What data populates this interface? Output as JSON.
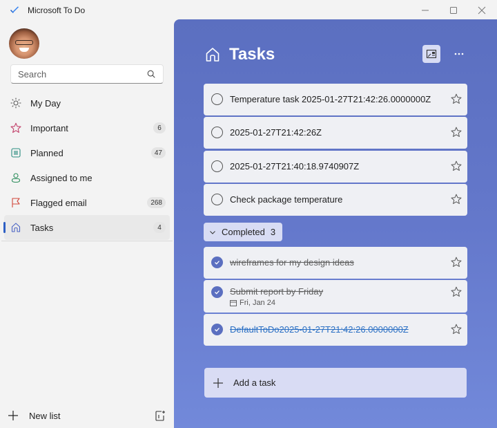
{
  "window": {
    "title": "Microsoft To Do",
    "controls": [
      "minimize",
      "maximize",
      "close"
    ]
  },
  "sidebar": {
    "search": {
      "placeholder": "Search",
      "value": ""
    },
    "items": [
      {
        "label": "My Day",
        "icon": "sun-icon",
        "count": null,
        "color": "#555555"
      },
      {
        "label": "Important",
        "icon": "star-icon",
        "count": "6",
        "color": "#c2406a"
      },
      {
        "label": "Planned",
        "icon": "calendar-grid-icon",
        "count": "47",
        "color": "#2a8c7f"
      },
      {
        "label": "Assigned to me",
        "icon": "person-icon",
        "count": null,
        "color": "#2a8c5a"
      },
      {
        "label": "Flagged email",
        "icon": "flag-icon",
        "count": "268",
        "color": "#d0463a"
      },
      {
        "label": "Tasks",
        "icon": "home-icon",
        "count": "4",
        "color": "#4a63c4",
        "active": true
      }
    ],
    "new_list_label": "New list"
  },
  "main": {
    "title": "Tasks",
    "accent": "#5b6fc0",
    "tasks": [
      {
        "title": "Temperature task 2025-01-27T21:42:26.0000000Z",
        "completed": false,
        "important": false
      },
      {
        "title": "2025-01-27T21:42:26Z",
        "completed": false,
        "important": false
      },
      {
        "title": "2025-01-27T21:40:18.9740907Z",
        "completed": false,
        "important": false
      },
      {
        "title": "Check package temperature",
        "completed": false,
        "important": false
      }
    ],
    "completed_section": {
      "label": "Completed",
      "count": "3",
      "expanded": true
    },
    "completed_tasks": [
      {
        "title": "wireframes for my design ideas",
        "completed": true,
        "important": false
      },
      {
        "title": "Submit report by Friday",
        "completed": true,
        "important": false,
        "due": "Fri, Jan 24"
      },
      {
        "title": "DefaultToDo2025-01-27T21:42:26.0000000Z",
        "completed": true,
        "important": false,
        "linked": true
      }
    ],
    "add_task": {
      "placeholder": "Add a task",
      "value": ""
    }
  }
}
